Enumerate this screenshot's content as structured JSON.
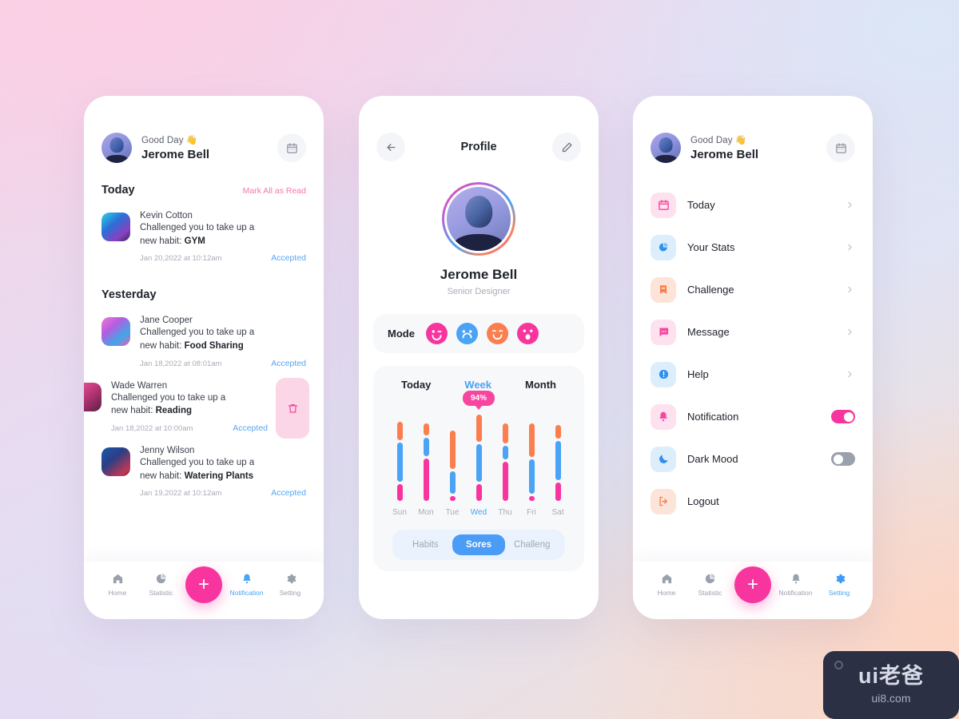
{
  "background": {
    "colors": [
      "#fbcfe5",
      "#dbe6f6",
      "#fcd5c4",
      "#e4dcf2"
    ]
  },
  "theme": {
    "pink": "#f8359e",
    "blue": "#4aa3f5",
    "orange": "#fb7e4e",
    "muted": "#a8acb6"
  },
  "header": {
    "greeting": "Good Day 👋",
    "name": "Jerome Bell",
    "calendar_icon": "calendar-icon"
  },
  "notifications_screen": {
    "sections": [
      {
        "title": "Today",
        "action_label": "Mark All as Read",
        "items": [
          {
            "name": "Kevin Cotton",
            "line1": "Challenged you to take up a",
            "line2_prefix": "new habit: ",
            "habit": "GYM",
            "time": "Jan 20,2022 at 10:12am",
            "status": "Accepted"
          }
        ]
      },
      {
        "title": "Yesterday",
        "items": [
          {
            "name": "Jane Cooper",
            "line1": "Challenged you to take up a",
            "line2_prefix": "new habit: ",
            "habit": "Food Sharing",
            "time": "Jan 18,2022 at 08:01am",
            "status": "Accepted"
          },
          {
            "name": "Wade Warren",
            "line1": "Challenged you to take up a",
            "line2_prefix": "new habit: ",
            "habit": "Reading",
            "time": "Jan 18,2022 at 10:00am",
            "status": "Accepted",
            "swiped": true,
            "delete_icon": "trash-icon"
          },
          {
            "name": "Jenny Wilson",
            "line1": "Challenged you to take up a",
            "line2_prefix": "new habit: ",
            "habit": "Watering Plants",
            "time": "Jan 19,2022 at 10:12am",
            "status": "Accepted"
          }
        ]
      }
    ]
  },
  "profile_screen": {
    "back_icon": "arrow-left-icon",
    "title": "Profile",
    "edit_icon": "pencil-icon",
    "name": "Jerome Bell",
    "role": "Senior Designer",
    "mode": {
      "label": "Mode",
      "emojis": [
        {
          "name": "emoji-wink",
          "color": "#f8359e"
        },
        {
          "name": "emoji-sad",
          "color": "#4aa3f5"
        },
        {
          "name": "emoji-smile",
          "color": "#fb7e4e"
        },
        {
          "name": "emoji-surprised",
          "color": "#f8359e"
        }
      ]
    },
    "range_tabs": [
      {
        "label": "Today",
        "active": false
      },
      {
        "label": "Week",
        "active": true
      },
      {
        "label": "Month",
        "active": false
      }
    ],
    "chips": [
      {
        "label": "Habits",
        "active": false
      },
      {
        "label": "Sores",
        "active": true
      },
      {
        "label": "Challeng",
        "active": false
      }
    ]
  },
  "chart_data": {
    "type": "bar",
    "title": "Week",
    "stacked": true,
    "categories": [
      "Sun",
      "Mon",
      "Tue",
      "Wed",
      "Thu",
      "Fri",
      "Sat"
    ],
    "series": [
      {
        "name": "orange",
        "color": "#fb7e4e",
        "values": [
          22,
          14,
          45,
          32,
          24,
          40,
          16
        ]
      },
      {
        "name": "blue",
        "color": "#4aa3f5",
        "values": [
          46,
          22,
          26,
          44,
          16,
          40,
          46
        ]
      },
      {
        "name": "pink",
        "color": "#f8359e",
        "values": [
          20,
          50,
          6,
          20,
          46,
          6,
          22
        ]
      }
    ],
    "highlight": {
      "category": "Wed",
      "label": "94%"
    },
    "ylim": [
      0,
      100
    ],
    "grid": false,
    "legend": false,
    "xlabel": "",
    "ylabel": ""
  },
  "settings_screen": {
    "items": [
      {
        "label": "Today",
        "icon": "calendar-icon",
        "tile": "tile-pink",
        "control": "chevron"
      },
      {
        "label": "Your Stats",
        "icon": "pie-chart-icon",
        "tile": "tile-blue",
        "control": "chevron"
      },
      {
        "label": "Challenge",
        "icon": "bookmark-icon",
        "tile": "tile-orange",
        "control": "chevron"
      },
      {
        "label": "Message",
        "icon": "message-icon",
        "tile": "tile-pink",
        "control": "chevron"
      },
      {
        "label": "Help",
        "icon": "info-icon",
        "tile": "tile-blue",
        "control": "chevron"
      },
      {
        "label": "Notification",
        "icon": "bell-icon",
        "tile": "tile-pink",
        "control": "toggle-on"
      },
      {
        "label": "Dark Mood",
        "icon": "moon-icon",
        "tile": "tile-blue",
        "control": "toggle-off"
      },
      {
        "label": "Logout",
        "icon": "logout-icon",
        "tile": "tile-orange",
        "control": "none"
      }
    ]
  },
  "bottom_nav": {
    "items": [
      {
        "label": "Home",
        "icon": "home-icon"
      },
      {
        "label": "Statistic",
        "icon": "statistic-icon"
      },
      {
        "label": "Notification",
        "icon": "bell-icon"
      },
      {
        "label": "Setting",
        "icon": "gear-icon"
      }
    ],
    "fab_label": "+",
    "active_on_notifications": "Notification",
    "active_on_settings": "Setting"
  },
  "watermark": {
    "main": "ui老爸",
    "sub": "ui8.com"
  }
}
